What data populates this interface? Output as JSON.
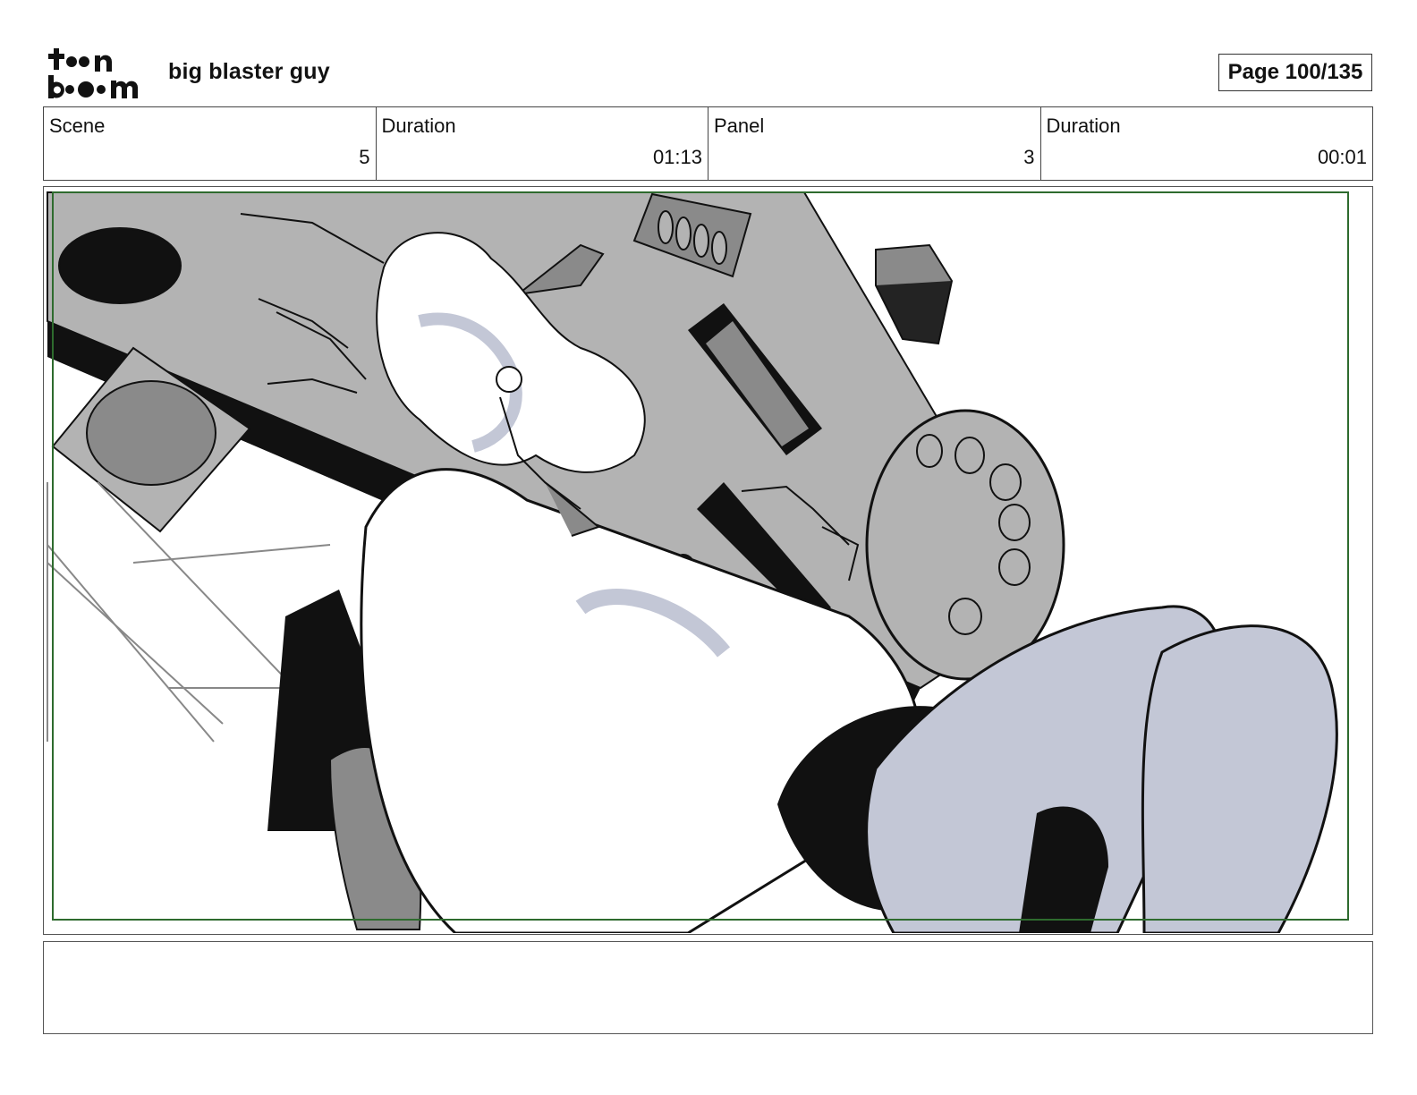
{
  "header": {
    "logo_text": "toon boom",
    "project_title": "big blaster guy",
    "page_indicator": "Page 100/135"
  },
  "meta": [
    {
      "label": "Scene",
      "value": "5"
    },
    {
      "label": "Duration",
      "value": "01:13"
    },
    {
      "label": "Panel",
      "value": "3"
    },
    {
      "label": "Duration",
      "value": "00:01"
    }
  ],
  "panel": {
    "safe_area_color": "#2e6b2e",
    "fill_gray": "#b3b3b3",
    "fill_dark_gray": "#8a8a8a",
    "fill_blue_gray": "#c3c7d6",
    "ink": "#111111"
  },
  "notes": {
    "text": ""
  }
}
